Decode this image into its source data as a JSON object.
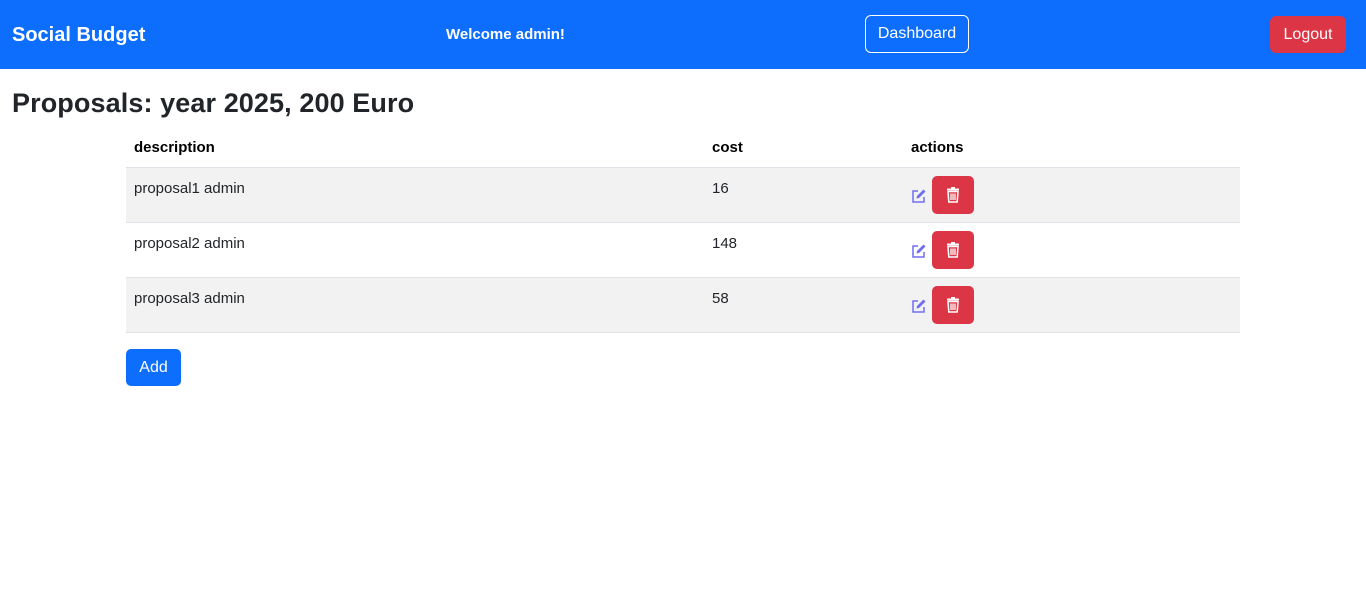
{
  "navbar": {
    "brand": "Social Budget",
    "welcome": "Welcome admin!",
    "dashboard_label": "Dashboard",
    "logout_label": "Logout",
    "bg_color": "#0d6efd"
  },
  "page": {
    "title": "Proposals: year 2025, 200 Euro"
  },
  "table": {
    "headers": {
      "description": "description",
      "cost": "cost",
      "actions": "actions"
    },
    "rows": [
      {
        "description": "proposal1 admin",
        "cost": "16",
        "edit_icon": "edit-icon",
        "delete_icon": "trash-icon"
      },
      {
        "description": "proposal2 admin",
        "cost": "148",
        "edit_icon": "edit-icon",
        "delete_icon": "trash-icon"
      },
      {
        "description": "proposal3 admin",
        "cost": "58",
        "edit_icon": "edit-icon",
        "delete_icon": "trash-icon"
      }
    ]
  },
  "actions": {
    "add_label": "Add"
  },
  "colors": {
    "primary": "#0d6efd",
    "danger": "#dc3545",
    "edit_icon": "#6f6ff0"
  }
}
